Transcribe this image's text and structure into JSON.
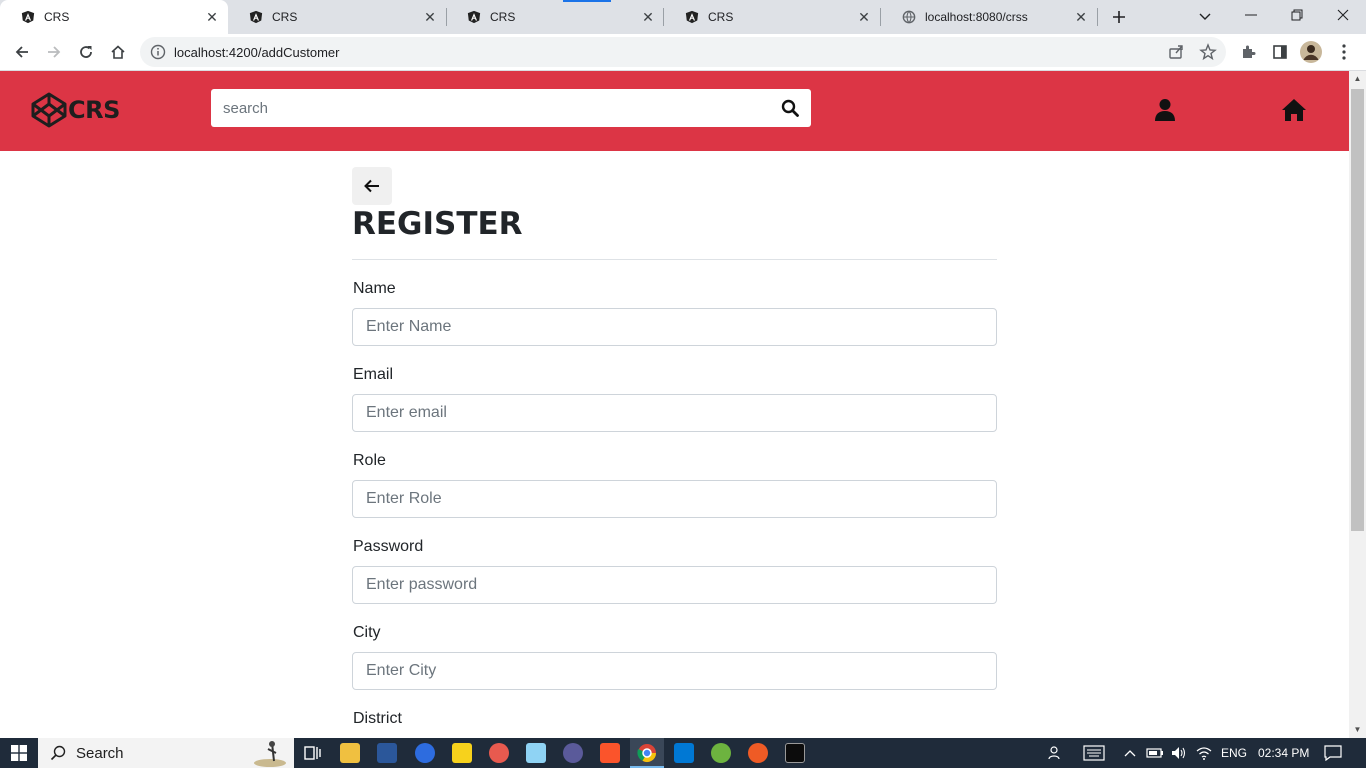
{
  "browser": {
    "tabs": [
      {
        "title": "CRS",
        "active": true
      },
      {
        "title": "CRS",
        "active": false
      },
      {
        "title": "CRS",
        "active": false
      },
      {
        "title": "CRS",
        "active": false
      },
      {
        "title": "localhost:8080/crss",
        "active": false
      }
    ],
    "url": "localhost:4200/addCustomer"
  },
  "header": {
    "logo_text": "CRS",
    "search_placeholder": "search",
    "brand_color": "#dc3545"
  },
  "form": {
    "title": "REGISTER",
    "fields": [
      {
        "label": "Name",
        "placeholder": "Enter Name"
      },
      {
        "label": "Email",
        "placeholder": "Enter email"
      },
      {
        "label": "Role",
        "placeholder": "Enter Role"
      },
      {
        "label": "Password",
        "placeholder": "Enter password"
      },
      {
        "label": "City",
        "placeholder": "Enter City"
      },
      {
        "label": "District",
        "placeholder": ""
      }
    ]
  },
  "taskbar": {
    "search_label": "Search",
    "language": "ENG",
    "time": "02:34 PM"
  }
}
